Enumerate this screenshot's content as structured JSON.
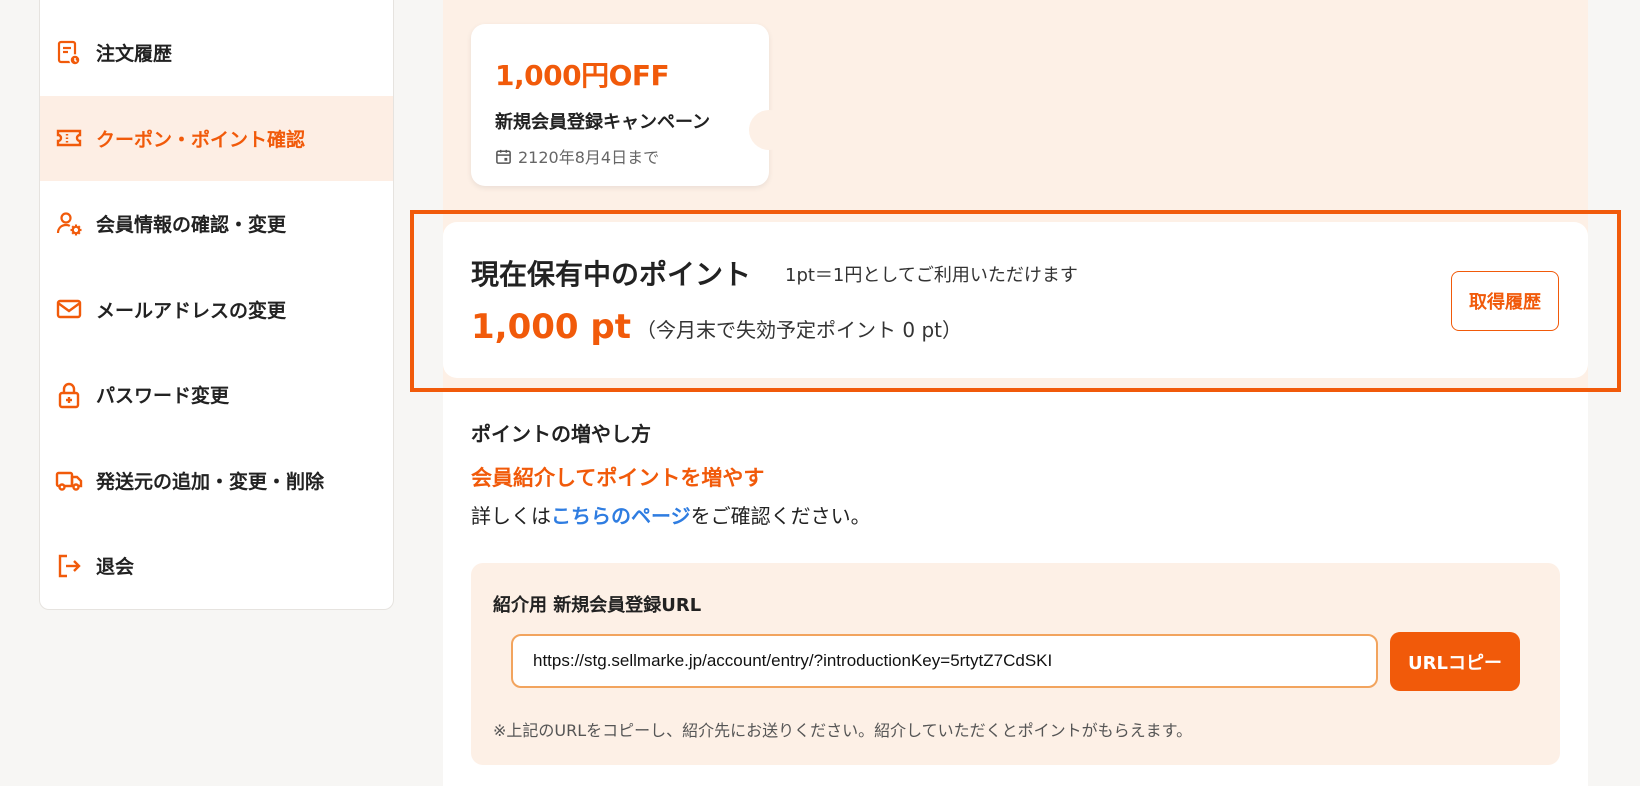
{
  "colors": {
    "accent": "#f15a0a",
    "link": "#2f7de1",
    "panel_bg": "#fdf0e6"
  },
  "sidebar": {
    "items": [
      {
        "label": "注文履歴",
        "icon": "order-history-icon",
        "active": false
      },
      {
        "label": "クーポン・ポイント確認",
        "icon": "ticket-icon",
        "active": true
      },
      {
        "label": "会員情報の確認・変更",
        "icon": "user-settings-icon",
        "active": false
      },
      {
        "label": "メールアドレスの変更",
        "icon": "mail-icon",
        "active": false
      },
      {
        "label": "パスワード変更",
        "icon": "lock-icon",
        "active": false
      },
      {
        "label": "発送元の追加・変更・削除",
        "icon": "truck-icon",
        "active": false
      },
      {
        "label": "退会",
        "icon": "logout-icon",
        "active": false
      }
    ]
  },
  "coupon": {
    "amount": "1,000円OFF",
    "name": "新規会員登録キャンペーン",
    "expiry": "2120年8月4日まで"
  },
  "points": {
    "title": "現在保有中のポイント",
    "note": "1pt＝1円としてご利用いただけます",
    "value": "1,000 pt",
    "expiring": "（今月末で失効予定ポイント 0 pt）",
    "history_button": "取得履歴"
  },
  "increase": {
    "title": "ポイントの増やし方",
    "referral_title": "会員紹介してポイントを増やす",
    "detail_prefix": "詳しくは",
    "detail_link": "こちらのページ",
    "detail_suffix": "をご確認ください。"
  },
  "referral_url": {
    "label": "紹介用 新規会員登録URL",
    "value": "https://stg.sellmarke.jp/account/entry/?introductionKey=5rtytZ7CdSKI",
    "copy_button": "URLコピー",
    "note": "※上記のURLをコピーし、紹介先にお送りください。紹介していただくとポイントがもらえます。"
  }
}
